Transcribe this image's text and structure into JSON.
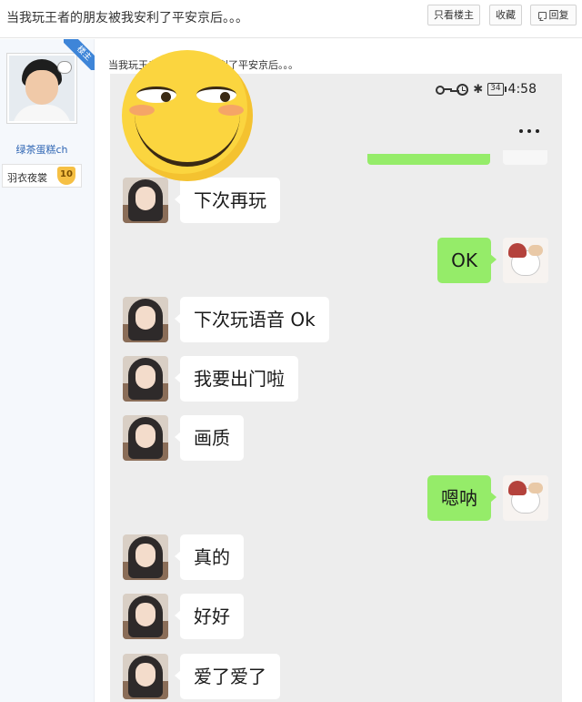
{
  "header": {
    "thread_title": "当我玩王者的朋友被我安利了平安京后。。。",
    "only_op_label": "只看楼主",
    "favorite_label": "收藏",
    "reply_label": "回复"
  },
  "author": {
    "op_tag": "楼主",
    "username": "绿茶蛋糕ch",
    "badge_name": "羽衣夜裳",
    "badge_level": "10"
  },
  "post": {
    "text": "当我玩王者的朋友被我安利了平安京后。。。",
    "screenshot": {
      "status": {
        "battery": "34",
        "time": "4:58"
      },
      "messages": [
        {
          "side": "left",
          "text": "下次再玩"
        },
        {
          "side": "right",
          "text": "OK"
        },
        {
          "side": "left",
          "text": "下次玩语音 Ok"
        },
        {
          "side": "left",
          "text": "我要出门啦"
        },
        {
          "side": "left",
          "text": "画质"
        },
        {
          "side": "right",
          "text": "嗯呐"
        },
        {
          "side": "left",
          "text": "真的"
        },
        {
          "side": "left",
          "text": "好好"
        },
        {
          "side": "left",
          "text": "爱了爱了"
        }
      ]
    }
  },
  "colors": {
    "sent_bubble": "#95ec69",
    "received_bubble": "#ffffff",
    "chat_background": "#ededed",
    "username_link": "#2d64b3",
    "op_ribbon": "#3e85d8"
  },
  "icons": [
    "reply-icon",
    "key-icon",
    "alarm-icon",
    "bluetooth-icon",
    "battery-icon",
    "more-icon",
    "emoji-sticker"
  ]
}
